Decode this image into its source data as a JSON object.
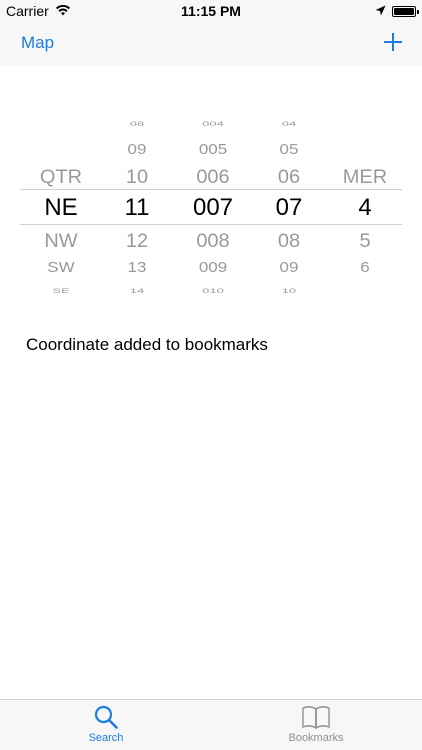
{
  "status_bar": {
    "carrier": "Carrier",
    "time": "11:15 PM",
    "icons": [
      "wifi-icon",
      "location-arrow-icon",
      "battery-icon"
    ],
    "battery_level": 1.0
  },
  "nav": {
    "left_label": "Map",
    "right_icon": "plus-icon"
  },
  "picker": {
    "columns": [
      {
        "name": "qtr",
        "above": [
          "",
          "",
          "QTR"
        ],
        "selected": "NE",
        "below": [
          "NW",
          "SW",
          "SE"
        ]
      },
      {
        "name": "hours",
        "above": [
          "08",
          "09",
          "10"
        ],
        "selected": "11",
        "below": [
          "12",
          "13",
          "14"
        ]
      },
      {
        "name": "easting",
        "above": [
          "004",
          "005",
          "006"
        ],
        "selected": "007",
        "below": [
          "008",
          "009",
          "010"
        ]
      },
      {
        "name": "northing",
        "above": [
          "04",
          "05",
          "06"
        ],
        "selected": "07",
        "below": [
          "08",
          "09",
          "10"
        ]
      },
      {
        "name": "mer",
        "above": [
          "",
          "",
          "MER"
        ],
        "selected": "4",
        "below": [
          "5",
          "6",
          ""
        ]
      }
    ]
  },
  "message": "Coordinate added to bookmarks",
  "tabs": [
    {
      "label": "Search",
      "icon": "search-icon",
      "active": true
    },
    {
      "label": "Bookmarks",
      "icon": "book-icon",
      "active": false
    }
  ],
  "colors": {
    "accent": "#1a7ee0",
    "inactive": "#8e8e93",
    "bar_bg": "#f7f7f7"
  }
}
